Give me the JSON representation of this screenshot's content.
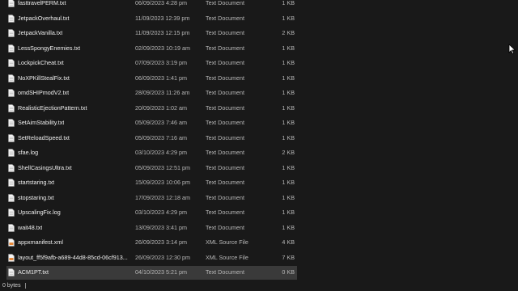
{
  "files": [
    {
      "name": "fasttravelPERM.txt",
      "date": "06/09/2023 4:28 pm",
      "type": "Text Document",
      "size": "1 KB",
      "icon": "text-file-icon"
    },
    {
      "name": "JetpackOverhaul.txt",
      "date": "11/09/2023 12:39 pm",
      "type": "Text Document",
      "size": "1 KB",
      "icon": "text-file-icon"
    },
    {
      "name": "JetpackVanilla.txt",
      "date": "11/09/2023 12:15 pm",
      "type": "Text Document",
      "size": "2 KB",
      "icon": "text-file-icon"
    },
    {
      "name": "LessSpongyEnemies.txt",
      "date": "02/09/2023 10:19 am",
      "type": "Text Document",
      "size": "1 KB",
      "icon": "text-file-icon"
    },
    {
      "name": "LockpickCheat.txt",
      "date": "07/09/2023 3:19 pm",
      "type": "Text Document",
      "size": "1 KB",
      "icon": "text-file-icon"
    },
    {
      "name": "NoXPKillStealFix.txt",
      "date": "06/09/2023 1:41 pm",
      "type": "Text Document",
      "size": "1 KB",
      "icon": "text-file-icon"
    },
    {
      "name": "omdSHIPmodV2.txt",
      "date": "28/09/2023 11:26 am",
      "type": "Text Document",
      "size": "1 KB",
      "icon": "text-file-icon"
    },
    {
      "name": "RealisticEjectionPattern.txt",
      "date": "20/09/2023 1:02 am",
      "type": "Text Document",
      "size": "1 KB",
      "icon": "text-file-icon"
    },
    {
      "name": "SetAimStability.txt",
      "date": "05/09/2023 7:46 am",
      "type": "Text Document",
      "size": "1 KB",
      "icon": "text-file-icon"
    },
    {
      "name": "SetReloadSpeed.txt",
      "date": "05/09/2023 7:16 am",
      "type": "Text Document",
      "size": "1 KB",
      "icon": "text-file-icon"
    },
    {
      "name": "sfae.log",
      "date": "03/10/2023 4:29 pm",
      "type": "Text Document",
      "size": "2 KB",
      "icon": "text-file-icon"
    },
    {
      "name": "ShellCasingsUltra.txt",
      "date": "05/09/2023 12:51 pm",
      "type": "Text Document",
      "size": "1 KB",
      "icon": "text-file-icon"
    },
    {
      "name": "startstaring.txt",
      "date": "15/09/2023 10:06 pm",
      "type": "Text Document",
      "size": "1 KB",
      "icon": "text-file-icon"
    },
    {
      "name": "stopstaring.txt",
      "date": "17/09/2023 12:18 am",
      "type": "Text Document",
      "size": "1 KB",
      "icon": "text-file-icon"
    },
    {
      "name": "UpscalingFix.log",
      "date": "03/10/2023 4:29 pm",
      "type": "Text Document",
      "size": "1 KB",
      "icon": "text-file-icon"
    },
    {
      "name": "wait48.txt",
      "date": "13/09/2023 3:41 pm",
      "type": "Text Document",
      "size": "1 KB",
      "icon": "text-file-icon"
    },
    {
      "name": "appxmanifest.xml",
      "date": "26/09/2023 3:14 pm",
      "type": "XML Source File",
      "size": "4 KB",
      "icon": "xml-file-icon"
    },
    {
      "name": "layout_ff5f9afb-a689-44d8-85cd-06cf913...",
      "date": "26/09/2023 12:30 pm",
      "type": "XML Source File",
      "size": "7 KB",
      "icon": "xml-file-icon"
    },
    {
      "name": "ACM1PT.txt",
      "date": "04/10/2023 5:21 pm",
      "type": "Text Document",
      "size": "0 KB",
      "icon": "text-file-icon",
      "selected": true
    }
  ],
  "status_bar": {
    "selection_size": "0 bytes"
  },
  "colors": {
    "background": "#191919",
    "selected_row": "#3a3a3a",
    "xml_icon_accent": "#e8893a"
  }
}
